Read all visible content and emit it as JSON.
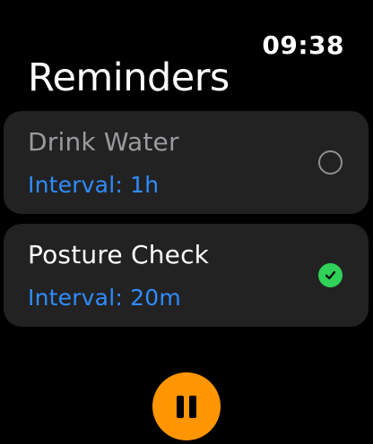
{
  "status_bar": {
    "time": "09:38"
  },
  "page": {
    "title": "Reminders"
  },
  "reminders": [
    {
      "name": "Drink Water",
      "interval": "Interval: 1h",
      "enabled": false,
      "status_icon": "empty-circle-icon"
    },
    {
      "name": "Posture Check",
      "interval": "Interval: 20m",
      "enabled": true,
      "status_icon": "checkmark-circle-icon"
    }
  ],
  "controls": {
    "pause_icon": "pause-icon"
  },
  "colors": {
    "background": "#000000",
    "card": "#222222",
    "accent_blue": "#2f8cff",
    "check_green": "#30d158",
    "pause_orange": "#ff9500",
    "disabled_text": "#9a9a9f"
  }
}
